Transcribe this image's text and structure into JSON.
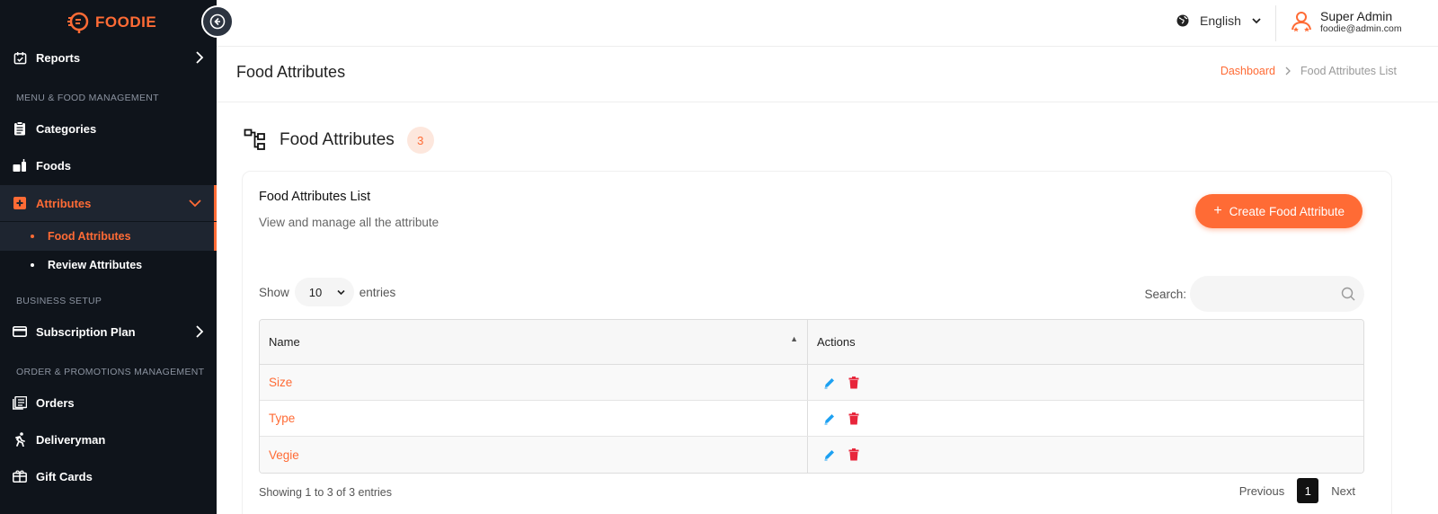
{
  "brand": {
    "name": "FOODIE",
    "accent": "#ff6b35",
    "sidebar_bg": "#0f141b"
  },
  "sidebar": {
    "reports_label": "Reports",
    "section_menu": "MENU & FOOD MANAGEMENT",
    "categories_label": "Categories",
    "foods_label": "Foods",
    "attributes_label": "Attributes",
    "food_attributes_label": "Food Attributes",
    "review_attributes_label": "Review Attributes",
    "section_business": "BUSINESS SETUP",
    "subscription_label": "Subscription Plan",
    "section_orders": "ORDER & PROMOTIONS MANAGEMENT",
    "orders_label": "Orders",
    "deliveryman_label": "Deliveryman",
    "giftcards_label": "Gift Cards"
  },
  "topbar": {
    "language": "English",
    "user_name": "Super Admin",
    "user_email": "foodie@admin.com"
  },
  "page_header": {
    "title": "Food Attributes",
    "breadcrumb_home": "Dashboard",
    "breadcrumb_current": "Food Attributes List"
  },
  "section": {
    "title": "Food Attributes",
    "count": "3"
  },
  "card": {
    "title": "Food Attributes List",
    "subtitle": "View and manage all the attribute",
    "create_label": "Create Food Attribute"
  },
  "table_controls": {
    "show_label": "Show",
    "entries_value": "10",
    "entries_label": "entries",
    "search_label": "Search:"
  },
  "table": {
    "columns": [
      "Name",
      "Actions"
    ],
    "rows": [
      {
        "name": "Size"
      },
      {
        "name": "Type"
      },
      {
        "name": "Vegie"
      }
    ]
  },
  "footer": {
    "info": "Showing 1 to 3 of 3 entries",
    "prev_label": "Previous",
    "current_page": "1",
    "next_label": "Next"
  }
}
